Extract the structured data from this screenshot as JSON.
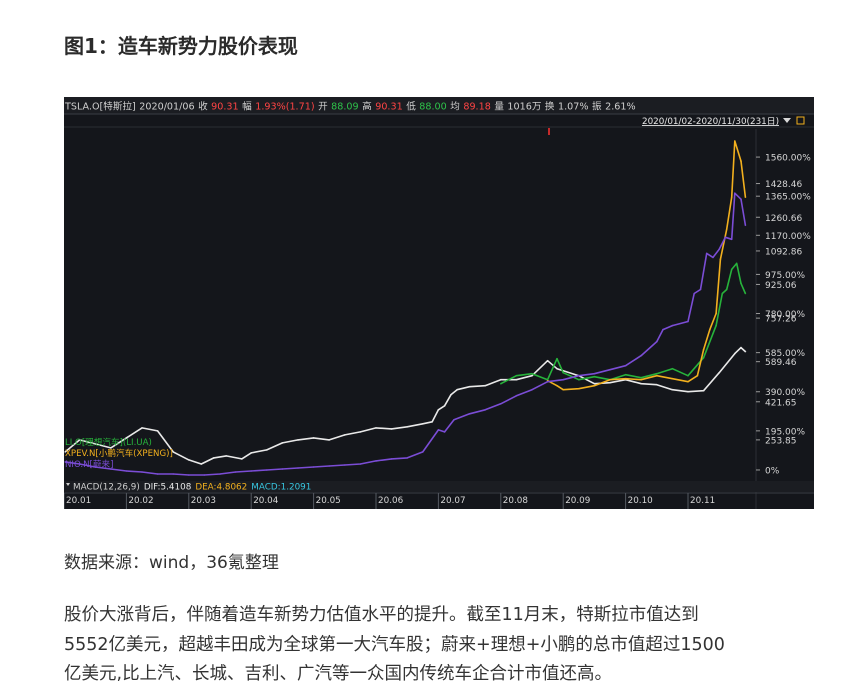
{
  "page": {
    "figure_title": "图1：造车新势力股价表现",
    "source": "数据来源：wind，36氪整理",
    "paragraph_lines": [
      "股价大涨背后，伴随着造车新势力估值水平的提升。截至11月末，特斯拉市值达到",
      "5552亿美元，超越丰田成为全球第一大汽车股；蔚来+理想+小鹏的总市值超过1500",
      "亿美元,比上汽、长城、吉利、广汽等一众国内传统车企合计市值还高。"
    ]
  },
  "colors": {
    "background": "#14161b",
    "tesla": "#e9e9e9",
    "li": "#27b33b",
    "xpeng": "#f2b01e",
    "nio": "#7b4dd6",
    "red_value": "#ff4444",
    "green_value": "#2ec24a",
    "header_text": "#cfcfcf"
  },
  "header": {
    "items": [
      {
        "text": "TSLA.O[特斯拉]",
        "color": "#cfcfcf"
      },
      {
        "text": "2020/01/06",
        "color": "#cfcfcf"
      },
      {
        "text": "收",
        "color": "#cfcfcf"
      },
      {
        "text": "90.31",
        "color": "#ff4444"
      },
      {
        "text": "幅",
        "color": "#cfcfcf"
      },
      {
        "text": "1.93%(1.71)",
        "color": "#ff4444"
      },
      {
        "text": "开",
        "color": "#cfcfcf"
      },
      {
        "text": "88.09",
        "color": "#2ec24a"
      },
      {
        "text": "高",
        "color": "#cfcfcf"
      },
      {
        "text": "90.31",
        "color": "#ff4444"
      },
      {
        "text": "低",
        "color": "#cfcfcf"
      },
      {
        "text": "88.00",
        "color": "#2ec24a"
      },
      {
        "text": "均",
        "color": "#cfcfcf"
      },
      {
        "text": "89.18",
        "color": "#ff4444"
      },
      {
        "text": "量",
        "color": "#cfcfcf"
      },
      {
        "text": "1016万",
        "color": "#cfcfcf"
      },
      {
        "text": "换",
        "color": "#cfcfcf"
      },
      {
        "text": "1.07%",
        "color": "#cfcfcf"
      },
      {
        "text": "振",
        "color": "#cfcfcf"
      },
      {
        "text": "2.61%",
        "color": "#cfcfcf"
      }
    ],
    "date_range": "2020/01/02-2020/11/30(231日)"
  },
  "macd": {
    "label": "MACD(12,26,9)",
    "dif": "DIF:5.4108",
    "dea": "DEA:4.8062",
    "macd": "MACD:1.2091",
    "dif_color": "#e9e9e9",
    "dea_color": "#f2b01e",
    "macd_color": "#38c6e0"
  },
  "chart_data": {
    "type": "line",
    "title": "",
    "y_unit": "%",
    "ylim": [
      -50,
      1700
    ],
    "right_axis_ticks": [
      {
        "label": "1560.00%",
        "value": 1560
      },
      {
        "label": "1428.46",
        "value": 1428
      },
      {
        "label": "1365.00%",
        "value": 1365
      },
      {
        "label": "1260.66",
        "value": 1260
      },
      {
        "label": "1170.00%",
        "value": 1170
      },
      {
        "label": "1092.86",
        "value": 1092
      },
      {
        "label": "975.00%",
        "value": 975
      },
      {
        "label": "925.06",
        "value": 925
      },
      {
        "label": "780.00%",
        "value": 780
      },
      {
        "label": "757.26",
        "value": 757
      },
      {
        "label": "585.00%",
        "value": 585
      },
      {
        "label": "589.46",
        "value": 540
      },
      {
        "label": "390.00%",
        "value": 390
      },
      {
        "label": "421.65",
        "value": 340
      },
      {
        "label": "195.00%",
        "value": 195
      },
      {
        "label": "253.85",
        "value": 150
      },
      {
        "label": "0%",
        "value": 0
      }
    ],
    "x_ticks": [
      "20.01",
      "20.02",
      "20.03",
      "20.04",
      "20.05",
      "20.06",
      "20.07",
      "20.08",
      "20.09",
      "20.10",
      "20.11"
    ],
    "legend": [
      {
        "text": "LI.O[理想汽车](LI.UA)",
        "color": "#27b33b"
      },
      {
        "text": "XPEV.N[小鹏汽车(XPENG)]",
        "color": "#f2b01e"
      },
      {
        "text": "NIO.N[蔚来]",
        "color": "#7b4dd6"
      }
    ],
    "series": [
      {
        "name": "TSLA.O[特斯拉]",
        "color": "#e9e9e9",
        "points": [
          [
            0.02,
            90
          ],
          [
            0.25,
            150
          ],
          [
            0.5,
            130
          ],
          [
            0.75,
            110
          ],
          [
            1.0,
            160
          ],
          [
            1.25,
            210
          ],
          [
            1.5,
            195
          ],
          [
            1.75,
            90
          ],
          [
            2.0,
            50
          ],
          [
            2.2,
            30
          ],
          [
            2.4,
            60
          ],
          [
            2.6,
            70
          ],
          [
            2.85,
            55
          ],
          [
            3.0,
            85
          ],
          [
            3.25,
            100
          ],
          [
            3.5,
            135
          ],
          [
            3.75,
            150
          ],
          [
            4.0,
            160
          ],
          [
            4.25,
            150
          ],
          [
            4.5,
            175
          ],
          [
            4.75,
            190
          ],
          [
            5.0,
            210
          ],
          [
            5.25,
            205
          ],
          [
            5.5,
            215
          ],
          [
            5.75,
            230
          ],
          [
            5.9,
            240
          ],
          [
            6.0,
            300
          ],
          [
            6.1,
            320
          ],
          [
            6.2,
            375
          ],
          [
            6.3,
            400
          ],
          [
            6.5,
            415
          ],
          [
            6.75,
            420
          ],
          [
            7.0,
            450
          ],
          [
            7.25,
            450
          ],
          [
            7.5,
            470
          ],
          [
            7.75,
            545
          ],
          [
            7.9,
            505
          ],
          [
            8.0,
            495
          ],
          [
            8.25,
            470
          ],
          [
            8.5,
            430
          ],
          [
            8.75,
            435
          ],
          [
            9.0,
            450
          ],
          [
            9.25,
            430
          ],
          [
            9.5,
            425
          ],
          [
            9.75,
            400
          ],
          [
            10.0,
            390
          ],
          [
            10.25,
            395
          ],
          [
            10.5,
            485
          ],
          [
            10.75,
            580
          ],
          [
            10.85,
            610
          ],
          [
            10.92,
            590
          ]
        ]
      },
      {
        "name": "LI.O[理想汽车](LI.UA)",
        "color": "#27b33b",
        "points": [
          [
            7.0,
            430
          ],
          [
            7.25,
            470
          ],
          [
            7.5,
            480
          ],
          [
            7.75,
            450
          ],
          [
            7.9,
            555
          ],
          [
            7.95,
            520
          ],
          [
            8.0,
            485
          ],
          [
            8.25,
            450
          ],
          [
            8.5,
            465
          ],
          [
            8.75,
            450
          ],
          [
            9.0,
            475
          ],
          [
            9.25,
            460
          ],
          [
            9.5,
            480
          ],
          [
            9.75,
            505
          ],
          [
            10.0,
            470
          ],
          [
            10.25,
            560
          ],
          [
            10.45,
            720
          ],
          [
            10.55,
            880
          ],
          [
            10.62,
            900
          ],
          [
            10.7,
            1000
          ],
          [
            10.78,
            1030
          ],
          [
            10.85,
            930
          ],
          [
            10.92,
            880
          ]
        ]
      },
      {
        "name": "XPEV.N[小鹏汽车(XPENG)]",
        "color": "#f2b01e",
        "points": [
          [
            7.75,
            445
          ],
          [
            7.9,
            420
          ],
          [
            8.0,
            400
          ],
          [
            8.25,
            405
          ],
          [
            8.5,
            420
          ],
          [
            8.75,
            450
          ],
          [
            9.0,
            455
          ],
          [
            9.25,
            450
          ],
          [
            9.5,
            470
          ],
          [
            9.75,
            455
          ],
          [
            10.0,
            440
          ],
          [
            10.15,
            470
          ],
          [
            10.25,
            600
          ],
          [
            10.35,
            700
          ],
          [
            10.45,
            780
          ],
          [
            10.52,
            1050
          ],
          [
            10.62,
            1200
          ],
          [
            10.7,
            1360
          ],
          [
            10.75,
            1640
          ],
          [
            10.85,
            1540
          ],
          [
            10.92,
            1360
          ]
        ]
      },
      {
        "name": "NIO.N[蔚来]",
        "color": "#7b4dd6",
        "points": [
          [
            0.02,
            40
          ],
          [
            0.25,
            30
          ],
          [
            0.5,
            15
          ],
          [
            0.75,
            5
          ],
          [
            1.0,
            -5
          ],
          [
            1.25,
            -10
          ],
          [
            1.5,
            -20
          ],
          [
            1.75,
            -20
          ],
          [
            2.0,
            -25
          ],
          [
            2.25,
            -25
          ],
          [
            2.5,
            -20
          ],
          [
            2.75,
            -10
          ],
          [
            3.0,
            -5
          ],
          [
            3.25,
            0
          ],
          [
            3.5,
            5
          ],
          [
            3.75,
            10
          ],
          [
            4.0,
            15
          ],
          [
            4.25,
            20
          ],
          [
            4.5,
            25
          ],
          [
            4.75,
            30
          ],
          [
            5.0,
            45
          ],
          [
            5.25,
            55
          ],
          [
            5.5,
            60
          ],
          [
            5.75,
            90
          ],
          [
            6.0,
            200
          ],
          [
            6.1,
            190
          ],
          [
            6.25,
            250
          ],
          [
            6.5,
            280
          ],
          [
            6.75,
            300
          ],
          [
            7.0,
            330
          ],
          [
            7.25,
            370
          ],
          [
            7.5,
            400
          ],
          [
            7.75,
            440
          ],
          [
            8.0,
            450
          ],
          [
            8.25,
            470
          ],
          [
            8.5,
            480
          ],
          [
            8.75,
            500
          ],
          [
            9.0,
            520
          ],
          [
            9.25,
            570
          ],
          [
            9.5,
            640
          ],
          [
            9.6,
            700
          ],
          [
            9.75,
            720
          ],
          [
            10.0,
            740
          ],
          [
            10.1,
            880
          ],
          [
            10.2,
            900
          ],
          [
            10.3,
            1080
          ],
          [
            10.4,
            1060
          ],
          [
            10.5,
            1100
          ],
          [
            10.6,
            1160
          ],
          [
            10.7,
            1150
          ],
          [
            10.75,
            1380
          ],
          [
            10.85,
            1350
          ],
          [
            10.92,
            1220
          ]
        ]
      }
    ]
  }
}
